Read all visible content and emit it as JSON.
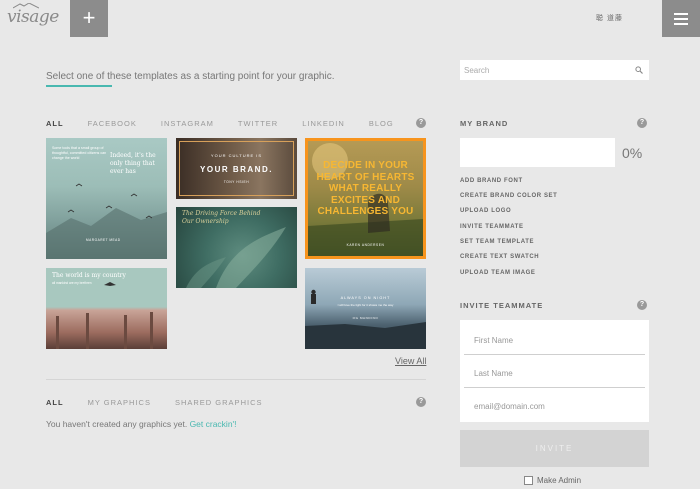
{
  "header": {
    "logo": "visage",
    "add_button": "+",
    "user_name": "聪 道藤"
  },
  "intro": {
    "text": "Select one of these templates as a starting point for your graphic."
  },
  "search": {
    "placeholder": "Search"
  },
  "template_tabs": [
    {
      "label": "ALL",
      "active": true
    },
    {
      "label": "FACEBOOK",
      "active": false
    },
    {
      "label": "INSTAGRAM",
      "active": false
    },
    {
      "label": "TWITTER",
      "active": false
    },
    {
      "label": "LINKEDIN",
      "active": false
    },
    {
      "label": "BLOG",
      "active": false
    }
  ],
  "help_glyph": "?",
  "templates": [
    {
      "text_a": "Some tools that a small group of thoughtful, committed citizens can change the world",
      "text_b": "Indeed, it's the only thing that ever has",
      "credit": "MARGARET MEAD"
    },
    {
      "text_a": "YOUR CULTURE IS",
      "text_b": "YOUR BRAND.",
      "credit": "TONY HSIEH"
    },
    {
      "text_a": "The Driving Force Behind Our Ownership"
    },
    {
      "text_a": "DECIDE IN YOUR HEART OF HEARTS WHAT REALLY EXCITES AND CHALLENGES YOU",
      "credit": "KAREN ANDERSEN"
    },
    {
      "text_a": "The world is my country",
      "text_b": "all mankind are my brethren"
    },
    {
      "text_a": "ALWAYS ON NIGHT",
      "text_b": "I will love the light for it shows me the way",
      "credit": "OG MANDINO"
    }
  ],
  "view_all": "View All",
  "graphics_tabs": [
    {
      "label": "ALL",
      "active": true
    },
    {
      "label": "MY GRAPHICS",
      "active": false
    },
    {
      "label": "SHARED GRAPHICS",
      "active": false
    }
  ],
  "empty_state": {
    "text": "You haven't created any graphics yet.",
    "link": "Get crackin'!"
  },
  "my_brand": {
    "title": "MY BRAND",
    "percent": "0%",
    "links": [
      "ADD BRAND FONT",
      "CREATE BRAND COLOR SET",
      "UPLOAD LOGO",
      "INVITE TEAMMATE",
      "SET TEAM TEMPLATE",
      "CREATE TEXT SWATCH",
      "UPLOAD TEAM IMAGE"
    ]
  },
  "invite": {
    "title": "INVITE TEAMMATE",
    "first_name_placeholder": "First Name",
    "last_name_placeholder": "Last Name",
    "email_placeholder": "email@domain.com",
    "button": "INVITE",
    "make_admin": "Make Admin"
  },
  "colors": {
    "accent": "#49b8b0",
    "header_button": "#8c8c8c",
    "selected_border": "#f7941d"
  }
}
